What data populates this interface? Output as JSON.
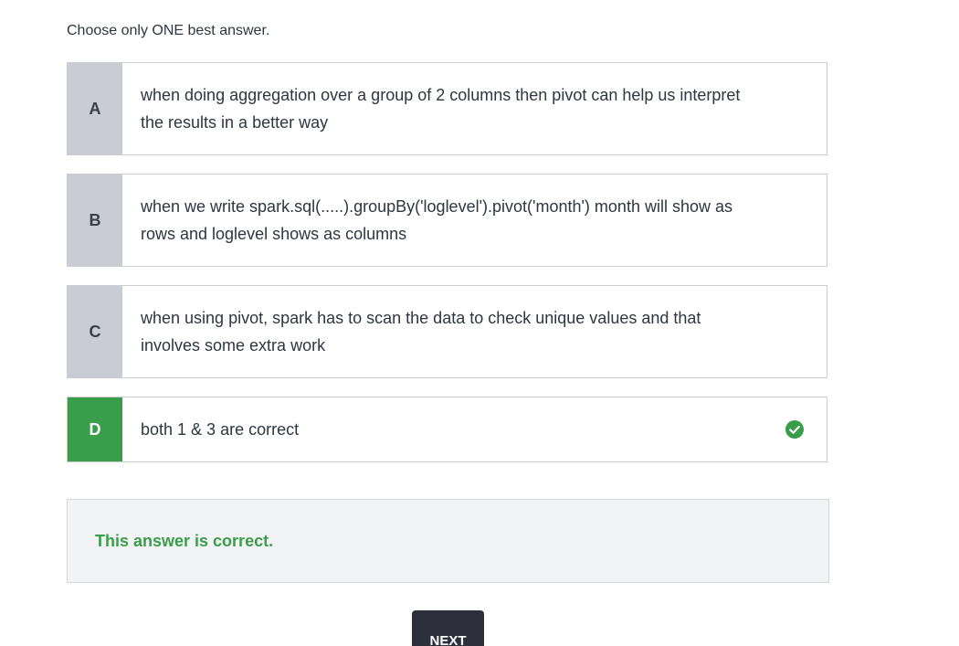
{
  "instruction": "Choose only ONE best answer.",
  "options": [
    {
      "letter": "A",
      "text": "when doing aggregation over a group of 2 columns then pivot can help us interpret the results in a better way",
      "selected": false
    },
    {
      "letter": "B",
      "text": "when we write spark.sql(.....).groupBy('loglevel').pivot('month') month will show as rows and loglevel shows as columns",
      "selected": false
    },
    {
      "letter": "C",
      "text": "when using pivot, spark has to scan the data to check unique values and that involves some extra work",
      "selected": false
    },
    {
      "letter": "D",
      "text": "both 1 & 3 are correct",
      "selected": true,
      "status_icon": "check-circle-icon"
    }
  ],
  "feedback": {
    "message": "This answer is correct.",
    "color": "#3a9d4a"
  },
  "next_button": {
    "label": "NEXT"
  },
  "colors": {
    "correct_green": "#3a9d4a",
    "letter_bg": "#c9ccd5",
    "button_dark": "#2d2f3d"
  }
}
